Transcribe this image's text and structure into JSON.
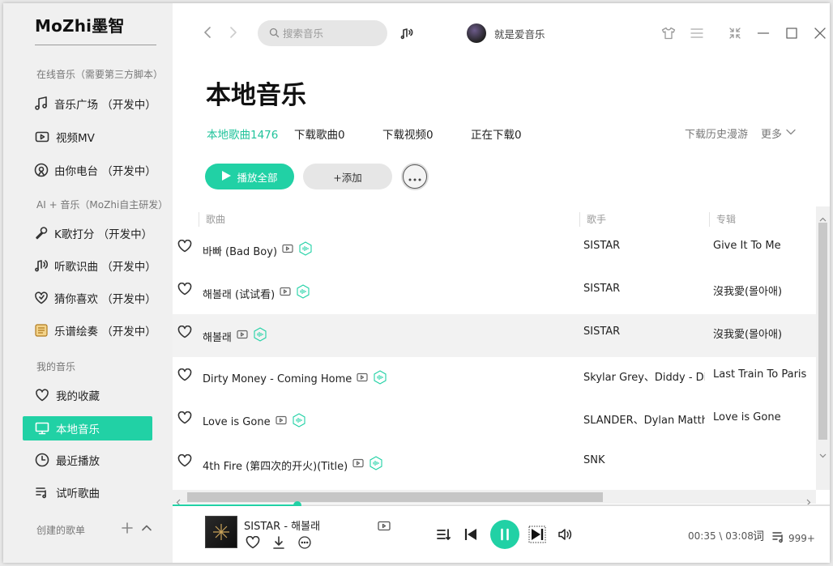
{
  "app": {
    "brand": "MoZhi墨智"
  },
  "sidebar": {
    "section_online": "在线音乐（需要第三方脚本）",
    "section_ai": "AI + 音乐（MoZhi自主研发）",
    "section_mine": "我的音乐",
    "section_created": "创建的歌单",
    "items": [
      {
        "label": "音乐广场  （开发中）",
        "icon": "music-note-icon"
      },
      {
        "label": "视频MV",
        "icon": "video-icon"
      },
      {
        "label": "由你电台  （开发中）",
        "icon": "radio-icon"
      },
      {
        "label": "K歌打分  （开发中）",
        "icon": "microphone-icon"
      },
      {
        "label": "听歌识曲  （开发中）",
        "icon": "listen-identify-icon"
      },
      {
        "label": "猜你喜欢  （开发中）",
        "icon": "heart-icon"
      },
      {
        "label": "乐谱绘奏  （开发中）",
        "icon": "score-icon"
      },
      {
        "label": "我的收藏",
        "icon": "heart-icon"
      },
      {
        "label": "本地音乐",
        "icon": "monitor-icon",
        "active": true
      },
      {
        "label": "最近播放",
        "icon": "clock-icon"
      },
      {
        "label": "试听歌曲",
        "icon": "playlist-icon"
      }
    ]
  },
  "topbar": {
    "search_placeholder": "搜索音乐",
    "username": "就是爱音乐"
  },
  "page": {
    "title": "本地音乐",
    "tabs": [
      "本地歌曲1476",
      "下载歌曲0",
      "下载视频0",
      "正在下载0"
    ],
    "roam": "下载历史漫游",
    "more": "更多",
    "play_all": "播放全部",
    "add": "+添加"
  },
  "table": {
    "headers": [
      "歌曲",
      "歌手",
      "专辑"
    ],
    "rows": [
      {
        "song": "바빠 (Bad Boy)",
        "artist": "SISTAR",
        "album": "Give It To Me"
      },
      {
        "song": "해볼래 (试试看)",
        "artist": "SISTAR",
        "album": "沒我愛(몰아애)"
      },
      {
        "song": "해볼래",
        "artist": "SISTAR",
        "album": "沒我愛(몰아애)",
        "highlight": true
      },
      {
        "song": "Dirty Money - Coming Home",
        "artist": "Skylar Grey、Diddy - Dirty Money",
        "album": "Last Train To Paris"
      },
      {
        "song": "Love is Gone",
        "artist": "SLANDER、Dylan Matthew",
        "album": "Love is Gone"
      },
      {
        "song": "4th Fire (第四次的开火)(Title)",
        "artist": "SNK",
        "album": ""
      }
    ]
  },
  "player": {
    "now_playing": "SISTAR - 해볼래",
    "progress": 0.19,
    "time": "00:35 \\ 03:08",
    "lyric": "词",
    "queue_count": "999+"
  },
  "colors": {
    "accent": "#21d1a5"
  }
}
